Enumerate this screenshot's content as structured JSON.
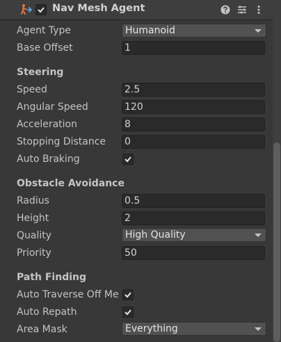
{
  "header": {
    "title": "Nav Mesh Agent",
    "icons": [
      "nav-mesh-agent-icon",
      "help-icon",
      "presets-icon",
      "more-menu-icon"
    ],
    "enabled": true
  },
  "fields": {
    "agent_type_label": "Agent Type",
    "agent_type_value": "Humanoid",
    "base_offset_label": "Base Offset",
    "base_offset_value": "1"
  },
  "steering": {
    "heading": "Steering",
    "speed_label": "Speed",
    "speed_value": "2.5",
    "angular_speed_label": "Angular Speed",
    "angular_speed_value": "120",
    "acceleration_label": "Acceleration",
    "acceleration_value": "8",
    "stopping_distance_label": "Stopping Distance",
    "stopping_distance_value": "0",
    "auto_braking_label": "Auto Braking",
    "auto_braking_checked": true
  },
  "obstacle_avoidance": {
    "heading": "Obstacle Avoidance",
    "radius_label": "Radius",
    "radius_value": "0.5",
    "height_label": "Height",
    "height_value": "2",
    "quality_label": "Quality",
    "quality_value": "High Quality",
    "priority_label": "Priority",
    "priority_value": "50"
  },
  "path_finding": {
    "heading": "Path Finding",
    "auto_traverse_label": "Auto Traverse Off Me",
    "auto_traverse_checked": true,
    "auto_repath_label": "Auto Repath",
    "auto_repath_checked": true,
    "area_mask_label": "Area Mask",
    "area_mask_value": "Everything"
  },
  "colors": {
    "background": "#383838",
    "field_bg": "#2a2a2a",
    "dropdown_bg": "#515151",
    "text": "#c4c4c4"
  }
}
